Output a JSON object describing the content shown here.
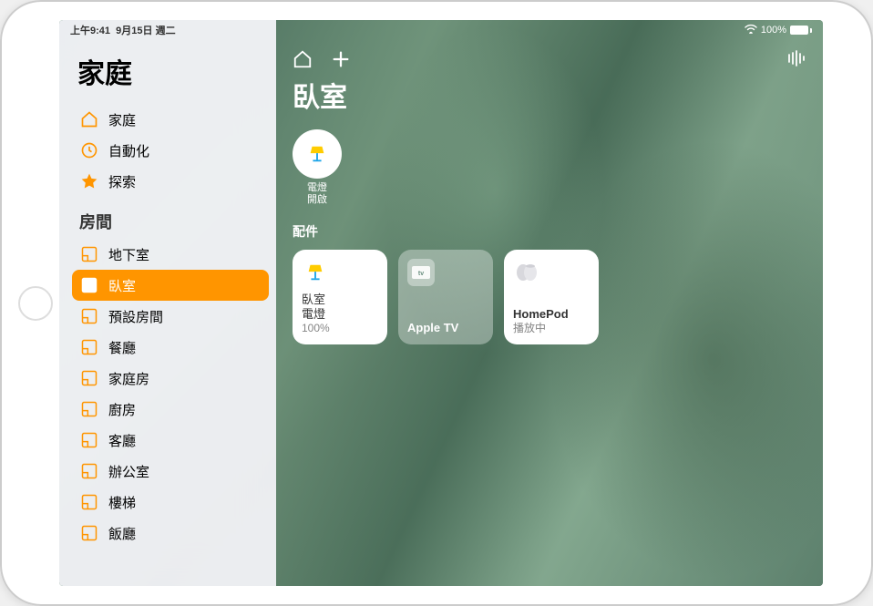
{
  "status": {
    "time": "上午9:41",
    "date": "9月15日 週二",
    "battery": "100%"
  },
  "sidebar": {
    "title": "家庭",
    "nav": [
      {
        "label": "家庭",
        "icon": "house"
      },
      {
        "label": "自動化",
        "icon": "clock"
      },
      {
        "label": "探索",
        "icon": "star"
      }
    ],
    "rooms_header": "房間",
    "rooms": [
      {
        "label": "地下室"
      },
      {
        "label": "臥室",
        "selected": true
      },
      {
        "label": "預設房間"
      },
      {
        "label": "餐廳"
      },
      {
        "label": "家庭房"
      },
      {
        "label": "廚房"
      },
      {
        "label": "客廳"
      },
      {
        "label": "辦公室"
      },
      {
        "label": "樓梯"
      },
      {
        "label": "飯廳"
      }
    ]
  },
  "main": {
    "room_title": "臥室",
    "scene": {
      "line1": "電燈",
      "line2": "開啟"
    },
    "accessories_label": "配件",
    "tiles": {
      "light": {
        "line1": "臥室",
        "line2": "電燈",
        "line3": "100%"
      },
      "appletv": {
        "label": "Apple TV"
      },
      "homepod": {
        "label": "HomePod",
        "status": "播放中"
      }
    }
  }
}
